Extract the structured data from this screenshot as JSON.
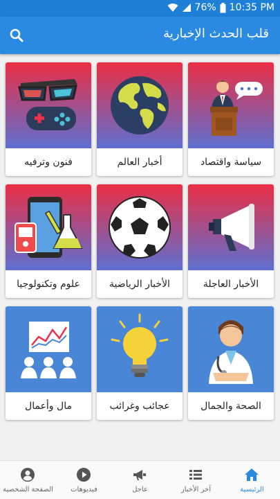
{
  "status_bar": {
    "battery": "76%",
    "time": "10:35 PM"
  },
  "app_bar": {
    "title": "قلب الحدث الإخبارية"
  },
  "categories": [
    {
      "label": "سياسة واقتصاد",
      "icon": "politician-podium-icon"
    },
    {
      "label": "أخبار العالم",
      "icon": "globe-icon"
    },
    {
      "label": "فنون وترفيه",
      "icon": "3d-glasses-gamepad-icon"
    },
    {
      "label": "الأخبار العاجلة",
      "icon": "megaphone-icon"
    },
    {
      "label": "الأخبار الرياضية",
      "icon": "soccer-ball-icon"
    },
    {
      "label": "علوم وتكنولوجيا",
      "icon": "devices-flask-icon"
    },
    {
      "label": "الصحة والجمال",
      "icon": "doctor-icon"
    },
    {
      "label": "عجائب وغرائب",
      "icon": "light-bulb-icon"
    },
    {
      "label": "مال وأعمال",
      "icon": "business-meeting-chart-icon"
    }
  ],
  "bottom_nav": [
    {
      "label": "الرئيسية",
      "icon": "home-icon",
      "active": true
    },
    {
      "label": "آخر الأخبار",
      "icon": "list-icon",
      "active": false
    },
    {
      "label": "عاجل",
      "icon": "megaphone-icon",
      "active": false
    },
    {
      "label": "فيديوهات",
      "icon": "play-icon",
      "active": false
    },
    {
      "label": "الصفحة الشخصية",
      "icon": "account-icon",
      "active": false
    }
  ],
  "colors": {
    "primary": "#2a8ae2",
    "status_bar": "#1e7fd6",
    "card_gradient_top": "#e8324a",
    "card_gradient_bottom": "#6a66c9"
  }
}
